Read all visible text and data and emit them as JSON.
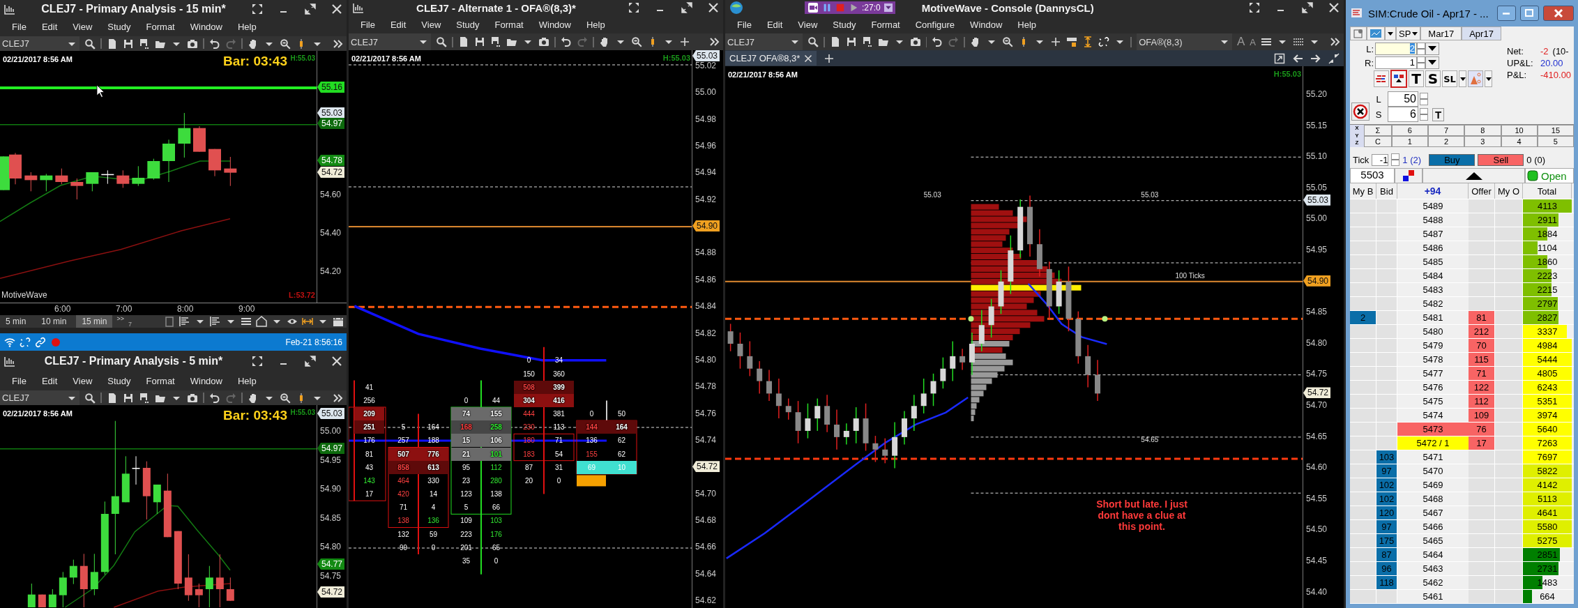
{
  "left_top_window": {
    "title": "CLEJ7 - Primary Analysis - 15 min*",
    "menu": [
      "File",
      "Edit",
      "View",
      "Study",
      "Format",
      "Window",
      "Help"
    ],
    "symbol": "CLEJ7",
    "chart": {
      "timestamp": "02/21/2017 8:56 AM",
      "bar_timer": "Bar: 03:43",
      "high": "H:55.03",
      "low": "L:53.72",
      "brand": "MotiveWave",
      "price_ticks": [
        "54.60",
        "54.40",
        "54.20"
      ],
      "price_tags": [
        {
          "label": "55.16",
          "color": "#22dd22"
        },
        {
          "label": "55.03",
          "color": "#dde6ee"
        },
        {
          "label": "54.97",
          "color": "#0d6a0d"
        },
        {
          "label": "54.78",
          "color": "#138a13"
        },
        {
          "label": "54.72",
          "color": "#f0ecd8"
        }
      ],
      "time_ticks": [
        "6:00",
        "7:00",
        "8:00",
        "9:00"
      ]
    },
    "timeframes": [
      {
        "label": "5 min",
        "selected": false
      },
      {
        "label": "10 min",
        "selected": false
      },
      {
        "label": "15 min",
        "selected": true
      }
    ],
    "more": ">>",
    "more_count": "7"
  },
  "status_bar": {
    "time": "Feb-21 8:56:16"
  },
  "left_bottom_window": {
    "title": "CLEJ7 - Primary Analysis - 5 min*",
    "menu": [
      "File",
      "Edit",
      "View",
      "Study",
      "Format",
      "Window",
      "Help"
    ],
    "symbol": "CLEJ7",
    "chart": {
      "timestamp": "02/21/2017 8:56 AM",
      "bar_timer": "Bar: 03:43",
      "high": "H:55.03",
      "price_ticks": [
        "55.00",
        "54.95",
        "54.90",
        "54.85",
        "54.80",
        "54.75"
      ],
      "price_tags": [
        {
          "label": "55.03",
          "color": "#dde6ee"
        },
        {
          "label": "54.97",
          "color": "#0d6a0d"
        },
        {
          "label": "54.77",
          "color": "#138a13"
        },
        {
          "label": "54.72",
          "color": "#f0ecd8"
        }
      ]
    }
  },
  "middle_window": {
    "title": "CLEJ7 - Alternate 1 - OFA®(8,3)*",
    "menu": [
      "File",
      "Edit",
      "View",
      "Study",
      "Format",
      "Window",
      "Help"
    ],
    "symbol": "CLEJ7",
    "chart": {
      "timestamp": "02/21/2017 8:56 AM",
      "high": "H:55.03",
      "price_ticks": [
        "55.02",
        "55.00",
        "54.98",
        "54.96",
        "54.94",
        "54.92",
        "54.88",
        "54.86",
        "54.84",
        "54.82",
        "54.80",
        "54.78",
        "54.76",
        "54.74",
        "54.70",
        "54.68",
        "54.66",
        "54.64",
        "54.62"
      ],
      "price_tags": [
        {
          "label": "55.03",
          "color": "#dde6ee"
        },
        {
          "label": "54.90",
          "color": "#f0a020"
        },
        {
          "label": "54.72",
          "color": "#f0ecd8"
        }
      ],
      "footprint": [
        {
          "cells": [
            {
              "ask": {
                "value": "41",
                "kind": "plain"
              },
              "kind": "plain"
            },
            {
              "ask": {
                "value": "256",
                "kind": "plain"
              },
              "kind": "plain"
            },
            {
              "ask": {
                "value": "209",
                "kind": "plain"
              },
              "kind": "heavy"
            },
            {
              "ask": {
                "value": "251",
                "kind": "plain"
              },
              "kind": "imbalance"
            },
            {
              "ask": {
                "value": "176",
                "kind": "plain"
              },
              "kind": "plain"
            },
            {
              "ask": {
                "value": "81",
                "kind": "plain"
              },
              "kind": "plain"
            },
            {
              "ask": {
                "value": "43",
                "kind": "plain"
              },
              "kind": "plain"
            },
            {
              "ask": {
                "value": "143",
                "kind": "buy"
              },
              "kind": "plain"
            },
            {
              "ask": {
                "value": "17",
                "kind": "plain"
              },
              "kind": "plain"
            }
          ]
        },
        {
          "cells": [
            {
              "bid": {
                "value": "5",
                "kind": "plain"
              },
              "ask": {
                "value": "164",
                "kind": "plain"
              },
              "kind": "plain"
            },
            {
              "bid": {
                "value": "257",
                "kind": "plain"
              },
              "ask": {
                "value": "188",
                "kind": "plain"
              },
              "kind": "plain"
            },
            {
              "bid": {
                "value": "507",
                "kind": "plain"
              },
              "ask": {
                "value": "776",
                "kind": "plain"
              },
              "kind": "heavy"
            },
            {
              "bid": {
                "value": "858",
                "kind": "sell"
              },
              "ask": {
                "value": "613",
                "kind": "plain"
              },
              "kind": "imbalance"
            },
            {
              "bid": {
                "value": "464",
                "kind": "sell"
              },
              "ask": {
                "value": "330",
                "kind": "plain"
              },
              "kind": "plain"
            },
            {
              "bid": {
                "value": "420",
                "kind": "sell"
              },
              "ask": {
                "value": "14",
                "kind": "plain"
              },
              "kind": "plain"
            },
            {
              "bid": {
                "value": "71",
                "kind": "plain"
              },
              "ask": {
                "value": "4",
                "kind": "plain"
              },
              "kind": "plain"
            },
            {
              "bid": {
                "value": "138",
                "kind": "sell"
              },
              "ask": {
                "value": "136",
                "kind": "buy"
              },
              "kind": "plain"
            },
            {
              "bid": {
                "value": "132",
                "kind": "plain"
              },
              "ask": {
                "value": "59",
                "kind": "plain"
              },
              "kind": "plain"
            },
            {
              "bid": {
                "value": "99",
                "kind": "plain"
              },
              "ask": {
                "value": "0",
                "kind": "plain"
              },
              "kind": "plain"
            }
          ]
        },
        {
          "cells": [
            {
              "bid": {
                "value": "0",
                "kind": "plain"
              },
              "ask": {
                "value": "44",
                "kind": "plain"
              },
              "kind": "plain"
            },
            {
              "bid": {
                "value": "74",
                "kind": "plain"
              },
              "ask": {
                "value": "155",
                "kind": "plain"
              },
              "kind": "value_area"
            },
            {
              "bid": {
                "value": "168",
                "kind": "sell"
              },
              "ask": {
                "value": "258",
                "kind": "buy"
              },
              "kind": "poc"
            },
            {
              "bid": {
                "value": "15",
                "kind": "plain"
              },
              "ask": {
                "value": "106",
                "kind": "plain"
              },
              "kind": "value_area"
            },
            {
              "bid": {
                "value": "21",
                "kind": "plain"
              },
              "ask": {
                "value": "101",
                "kind": "buy"
              },
              "kind": "value_area"
            },
            {
              "bid": {
                "value": "95",
                "kind": "plain"
              },
              "ask": {
                "value": "112",
                "kind": "buy"
              },
              "kind": "plain"
            },
            {
              "bid": {
                "value": "23",
                "kind": "plain"
              },
              "ask": {
                "value": "280",
                "kind": "buy"
              },
              "kind": "plain"
            },
            {
              "bid": {
                "value": "123",
                "kind": "plain"
              },
              "ask": {
                "value": "138",
                "kind": "plain"
              },
              "kind": "plain"
            },
            {
              "bid": {
                "value": "5",
                "kind": "plain"
              },
              "ask": {
                "value": "66",
                "kind": "plain"
              },
              "kind": "plain"
            },
            {
              "bid": {
                "value": "109",
                "kind": "plain"
              },
              "ask": {
                "value": "103",
                "kind": "buy"
              },
              "kind": "plain"
            },
            {
              "bid": {
                "value": "223",
                "kind": "plain"
              },
              "ask": {
                "value": "176",
                "kind": "buy"
              },
              "kind": "plain"
            },
            {
              "bid": {
                "value": "201",
                "kind": "plain"
              },
              "ask": {
                "value": "65",
                "kind": "plain"
              },
              "kind": "plain"
            },
            {
              "bid": {
                "value": "35",
                "kind": "plain"
              },
              "ask": {
                "value": "0",
                "kind": "plain"
              },
              "kind": "plain"
            }
          ]
        },
        {
          "cells": [
            {
              "bid": {
                "value": "0",
                "kind": "plain"
              },
              "ask": {
                "value": "34",
                "kind": "plain"
              },
              "kind": "plain"
            },
            {
              "bid": {
                "value": "150",
                "kind": "plain"
              },
              "ask": {
                "value": "360",
                "kind": "plain"
              },
              "kind": "plain"
            },
            {
              "bid": {
                "value": "508",
                "kind": "sell"
              },
              "ask": {
                "value": "399",
                "kind": "plain"
              },
              "kind": "imbalance"
            },
            {
              "bid": {
                "value": "304",
                "kind": "plain"
              },
              "ask": {
                "value": "416",
                "kind": "plain"
              },
              "kind": "heavy"
            },
            {
              "bid": {
                "value": "444",
                "kind": "sell"
              },
              "ask": {
                "value": "381",
                "kind": "plain"
              },
              "kind": "plain"
            },
            {
              "bid": {
                "value": "230",
                "kind": "sell"
              },
              "ask": {
                "value": "113",
                "kind": "plain"
              },
              "kind": "plain"
            },
            {
              "bid": {
                "value": "180",
                "kind": "sell"
              },
              "ask": {
                "value": "71",
                "kind": "plain"
              },
              "kind": "plain"
            },
            {
              "bid": {
                "value": "183",
                "kind": "sell"
              },
              "ask": {
                "value": "54",
                "kind": "plain"
              },
              "kind": "plain"
            },
            {
              "bid": {
                "value": "87",
                "kind": "plain"
              },
              "ask": {
                "value": "31",
                "kind": "plain"
              },
              "kind": "plain"
            },
            {
              "bid": {
                "value": "20",
                "kind": "plain"
              },
              "ask": {
                "value": "0",
                "kind": "plain"
              },
              "kind": "plain"
            }
          ]
        },
        {
          "cells": [
            {
              "bid": {
                "value": "0",
                "kind": "plain"
              },
              "ask": {
                "value": "50",
                "kind": "plain"
              },
              "kind": "plain"
            },
            {
              "bid": {
                "value": "144",
                "kind": "sell"
              },
              "ask": {
                "value": "164",
                "kind": "plain"
              },
              "kind": "imbalance"
            },
            {
              "bid": {
                "value": "136",
                "kind": "plain"
              },
              "ask": {
                "value": "62",
                "kind": "plain"
              },
              "kind": "plain"
            },
            {
              "bid": {
                "value": "155",
                "kind": "sell"
              },
              "ask": {
                "value": "62",
                "kind": "plain"
              },
              "kind": "plain"
            },
            {
              "bid": {
                "value": "69",
                "kind": "plain"
              },
              "ask": {
                "value": "10",
                "kind": "plain"
              },
              "kind": "last"
            }
          ]
        }
      ]
    }
  },
  "console_window": {
    "title": "MotiveWave - Console (DannysCL)",
    "replay_timer": ":27:0",
    "menu": [
      "File",
      "Edit",
      "View",
      "Study",
      "Format",
      "Configure",
      "Window",
      "Help"
    ],
    "symbol": "CLEJ7",
    "study": "OFA®(8,3)",
    "font_buttons": [
      "A",
      "A"
    ],
    "tabs": [
      {
        "label": "CLEJ7 OFA®8,3*",
        "selected": true
      }
    ],
    "chart": {
      "timestamp": "02/21/2017 8:56 AM",
      "high": "H:55.03",
      "price_ticks": [
        "55.20",
        "55.15",
        "55.10",
        "55.05",
        "55.00",
        "54.95",
        "54.85",
        "54.80",
        "54.75",
        "54.70",
        "54.65",
        "54.60",
        "54.55",
        "54.50",
        "54.45",
        "54.40"
      ],
      "price_tags": [
        {
          "label": "55.03",
          "color": "#dde6ee"
        },
        {
          "label": "54.90",
          "color": "#f0a020"
        },
        {
          "label": "54.72",
          "color": "#f0ecd8"
        }
      ],
      "annotations": [
        "55.03",
        "55.03",
        "100 Ticks",
        "54.65"
      ],
      "note": "Short but late. I just dont have a clue at this point."
    }
  },
  "dom_window": {
    "title": "SIM:Crude Oil - Apr17 - ...",
    "account": "SP",
    "months": [
      {
        "label": "Mar17",
        "selected": false
      },
      {
        "label": "Apr17",
        "selected": true
      }
    ],
    "qty_labels": [
      "L:",
      "R:"
    ],
    "limit_qty": "2",
    "r_qty": "1",
    "stats": [
      {
        "label": "Net:",
        "value": "-2",
        "extra": "(10-",
        "color": "#e02020"
      },
      {
        "label": "UP&L:",
        "value": "20.00",
        "color": "#2030d0"
      },
      {
        "label": "P&L:",
        "value": "-410.00",
        "color": "#e02020"
      }
    ],
    "tool_buttons": [
      "T",
      "S",
      "SL"
    ],
    "size_labels": [
      "L",
      "S"
    ],
    "l_size": "50",
    "s_size": "6",
    "t_button": "T",
    "grid": {
      "row_labels": [
        "X",
        "Y",
        "Z"
      ],
      "rows": [
        [
          "Σ",
          "6",
          "7",
          "8",
          "10",
          "15"
        ],
        [
          "C",
          "1",
          "2",
          "3",
          "4",
          "5"
        ]
      ]
    },
    "tick": {
      "label": "Tick",
      "value": "-1",
      "position": "1 (2)",
      "buy": "Buy",
      "sell": "Sell",
      "orders": "0 (0)"
    },
    "price_field": "5503",
    "status": "Open",
    "headers": [
      "My B",
      "Bid",
      "+94",
      "Offer",
      "My O",
      "Total"
    ],
    "rows": [
      {
        "price": "5489",
        "total": "4113",
        "level": 1.0,
        "color": "#7fbf00",
        "kind": "level"
      },
      {
        "price": "5488",
        "total": "2911",
        "level": 0.73,
        "color": "#7fbf00",
        "kind": "level"
      },
      {
        "price": "5487",
        "total": "1884",
        "level": 0.5,
        "color": "#7fbf00",
        "kind": "level"
      },
      {
        "price": "5486",
        "total": "1104",
        "level": 0.3,
        "color": "#7fbf00",
        "kind": "level"
      },
      {
        "price": "5485",
        "total": "1860",
        "level": 0.5,
        "color": "#7fbf00",
        "kind": "level"
      },
      {
        "price": "5484",
        "total": "2223",
        "level": 0.58,
        "color": "#7fbf00",
        "kind": "level"
      },
      {
        "price": "5483",
        "total": "2215",
        "level": 0.58,
        "color": "#7fbf00",
        "kind": "level"
      },
      {
        "price": "5482",
        "total": "2797",
        "level": 0.72,
        "color": "#7fbf00",
        "kind": "level"
      },
      {
        "price": "5481",
        "total": "2827",
        "level": 0.73,
        "color": "#7fbf00",
        "kind": "level",
        "my_bid": "2",
        "offer": "81"
      },
      {
        "price": "5480",
        "total": "3337",
        "level": 0.9,
        "color": "#ffff00",
        "kind": "level",
        "offer": "212"
      },
      {
        "price": "5479",
        "total": "4984",
        "level": 1.0,
        "color": "#ffff00",
        "kind": "level",
        "offer": "70"
      },
      {
        "price": "5478",
        "total": "5444",
        "level": 1.0,
        "color": "#ffff00",
        "kind": "level",
        "offer": "115"
      },
      {
        "price": "5477",
        "total": "4805",
        "level": 1.0,
        "color": "#ffff00",
        "kind": "level",
        "offer": "71"
      },
      {
        "price": "5476",
        "total": "6243",
        "level": 1.0,
        "color": "#ffff00",
        "kind": "level",
        "offer": "122"
      },
      {
        "price": "5475",
        "total": "5351",
        "level": 1.0,
        "color": "#ffff00",
        "kind": "level",
        "offer": "112"
      },
      {
        "price": "5474",
        "total": "3974",
        "level": 1.0,
        "color": "#ffff00",
        "kind": "level",
        "offer": "109"
      },
      {
        "price": "5473",
        "total": "5640",
        "level": 1.0,
        "color": "#ffff00",
        "kind": "best_offer",
        "offer": "76"
      },
      {
        "price": "5472 / 1",
        "total": "7263",
        "level": 1.0,
        "color": "#ffff00",
        "kind": "last_trade",
        "offer": "17"
      },
      {
        "price": "5471",
        "total": "7697",
        "level": 1.0,
        "color": "#ffff00",
        "kind": "level",
        "bid": "103"
      },
      {
        "price": "5470",
        "total": "5822",
        "level": 1.0,
        "color": "#dfef00",
        "kind": "level",
        "bid": "97"
      },
      {
        "price": "5469",
        "total": "4142",
        "level": 1.0,
        "color": "#dfef00",
        "kind": "level",
        "bid": "102"
      },
      {
        "price": "5468",
        "total": "5113",
        "level": 1.0,
        "color": "#dfef00",
        "kind": "level",
        "bid": "102"
      },
      {
        "price": "5467",
        "total": "4641",
        "level": 1.0,
        "color": "#dfef00",
        "kind": "level",
        "bid": "120"
      },
      {
        "price": "5466",
        "total": "5580",
        "level": 1.0,
        "color": "#dfef00",
        "kind": "level",
        "bid": "97"
      },
      {
        "price": "5465",
        "total": "5275",
        "level": 1.0,
        "color": "#dfef00",
        "kind": "level",
        "bid": "175"
      },
      {
        "price": "5464",
        "total": "2851",
        "level": 0.75,
        "color": "#007f00",
        "kind": "level",
        "bid": "87"
      },
      {
        "price": "5463",
        "total": "2731",
        "level": 0.73,
        "color": "#007f00",
        "kind": "level",
        "bid": "96"
      },
      {
        "price": "5462",
        "total": "1483",
        "level": 0.4,
        "color": "#007f00",
        "kind": "level",
        "bid": "118"
      },
      {
        "price": "5461",
        "total": "664",
        "level": 0.18,
        "color": "#007f00",
        "kind": "level"
      }
    ]
  }
}
